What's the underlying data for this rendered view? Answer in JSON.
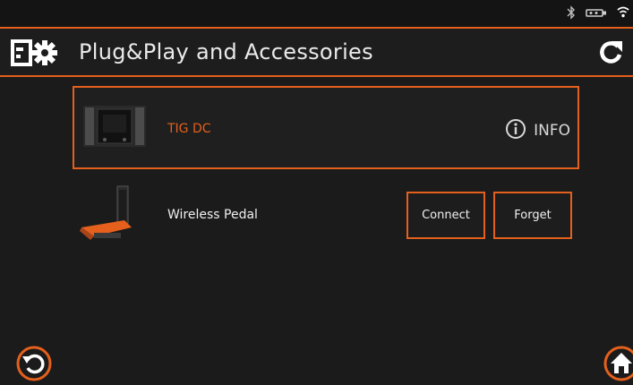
{
  "header": {
    "title": "Plug&Play and Accessories"
  },
  "statusbar": {
    "icons": [
      "bluetooth-icon",
      "usb-icon",
      "wifi-icon"
    ]
  },
  "devices": [
    {
      "name": "TIG DC",
      "action_label": "INFO",
      "icon": "tig-dc-unit-icon",
      "highlighted": true
    },
    {
      "name": "Wireless Pedal",
      "actions": [
        "Connect",
        "Forget"
      ],
      "icon": "wireless-pedal-icon"
    }
  ],
  "footer": {
    "back_icon": "undo-icon",
    "home_icon": "home-icon"
  },
  "colors": {
    "accent": "#e4601c",
    "background": "#1b1b1b",
    "text": "#e9e9e9"
  }
}
